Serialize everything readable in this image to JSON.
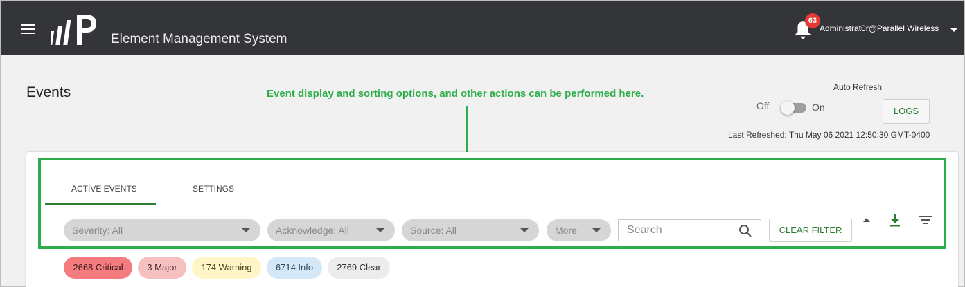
{
  "header": {
    "app_title": "Element Management System",
    "notification_count": "63",
    "user": "Administrat0r@Parallel Wireless"
  },
  "page": {
    "title": "Events",
    "annotation": "Event display and sorting options, and other actions can be performed here."
  },
  "refresh": {
    "auto_refresh_label": "Auto Refresh",
    "off_label": "Off",
    "on_label": "On",
    "auto_refresh_on": false,
    "logs_label": "LOGS",
    "last_refreshed": "Last Refreshed: Thu May 06 2021 12:50:30 GMT-0400"
  },
  "tabs": [
    {
      "label": "ACTIVE EVENTS",
      "active": true
    },
    {
      "label": "SETTINGS",
      "active": false
    }
  ],
  "filters": {
    "severity": "Severity: All",
    "acknowledge": "Acknowledge: All",
    "source": "Source: All",
    "more": "More",
    "search_placeholder": "Search",
    "clear_filter": "CLEAR FILTER"
  },
  "chips": [
    {
      "label": "2668 Critical"
    },
    {
      "label": "3 Major"
    },
    {
      "label": "174 Warning"
    },
    {
      "label": "6714 Info"
    },
    {
      "label": "2769 Clear"
    }
  ],
  "colors": {
    "header_bg": "#333538",
    "accent_green": "#2e7d32",
    "annotation_green": "#2eae4a",
    "badge_red": "#e53935",
    "critical": "#f47c7f",
    "major": "#f6c0c0",
    "warning": "#fff5c7",
    "info": "#d4e8f7",
    "clear": "#ececec"
  },
  "icons": [
    "menu-icon",
    "logo-icon",
    "bell-icon",
    "chevron-down-icon",
    "search-icon",
    "sort-up-icon",
    "download-icon",
    "filter-icon"
  ]
}
